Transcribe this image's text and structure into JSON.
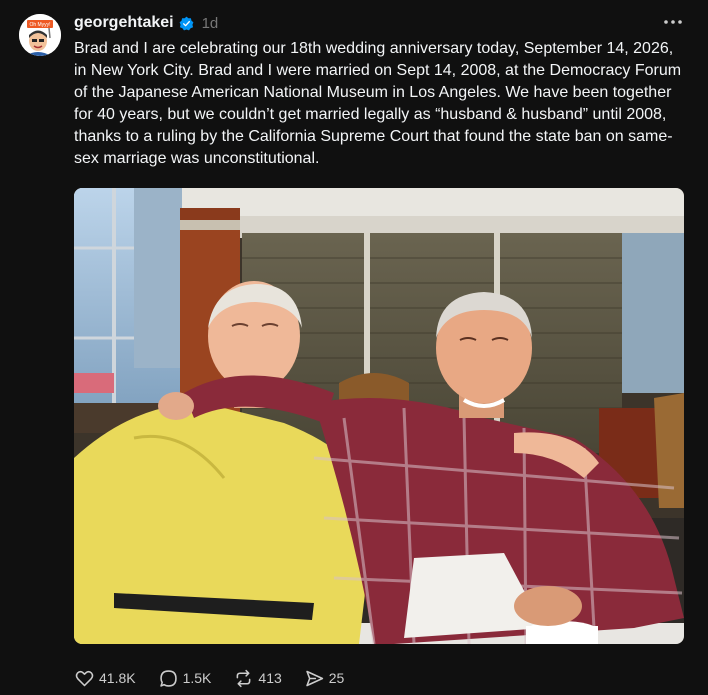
{
  "post": {
    "username": "georgehtakei",
    "verified_icon": "verified-badge-icon",
    "time": "1d",
    "caption": "Brad and I are celebrating our 18th wedding anniversary today, September 14, 2026, in New York City. Brad and I were married on Sept 14, 2008, at the Democracy Forum of the Japanese American National Museum in Los Angeles. We have been together for 40 years, but we couldn’t get married legally as “husband & husband” until 2008, thanks to a ruling by the California Supreme Court that found the state ban on same-sex marriage was unconstitutional.",
    "avatar_sign": "Oh Myyy!"
  },
  "actions": {
    "likes": "41.8K",
    "comments": "1.5K",
    "reposts": "413",
    "shares": "25"
  },
  "colors": {
    "background": "#101010",
    "text": "#f3f5f7",
    "muted": "#777777",
    "verified": "#0095f6",
    "avatar_sign": "#ee5a24"
  }
}
